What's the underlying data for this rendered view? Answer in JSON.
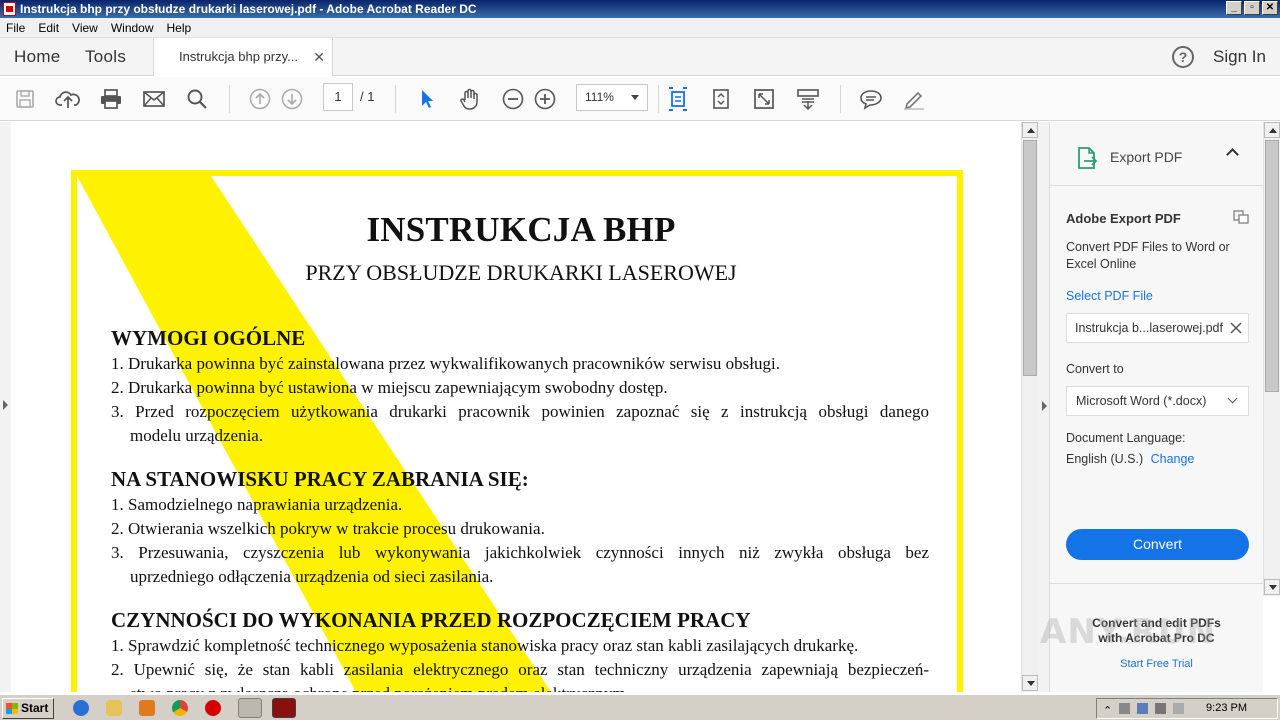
{
  "window": {
    "title": "Instrukcja bhp przy obsłudze drukarki laserowej.pdf - Adobe Acrobat Reader DC",
    "buttons": [
      "_",
      "▫",
      "✕"
    ]
  },
  "menu": [
    "File",
    "Edit",
    "View",
    "Window",
    "Help"
  ],
  "tabs": {
    "home": "Home",
    "tools": "Tools",
    "document": "Instrukcja bhp przy...",
    "sign_in": "Sign In"
  },
  "toolbar": {
    "page_current": "1",
    "page_total": "/ 1",
    "zoom": "111%"
  },
  "document": {
    "title": "INSTRUKCJA BHP",
    "subtitle": "PRZY OBSŁUDZE DRUKARKI LASEROWEJ",
    "sections": [
      {
        "heading": "WYMOGI OGÓLNE",
        "items": [
          "1. Drukarka powinna być zainstalowana przez wykwalifikowanych pracowników serwisu obsługi.",
          "2. Drukarka powinna być ustawiona w miejscu zapewniającym swobodny dostęp.",
          "3. Przed rozpoczęciem użytkowania drukarki pracownik powinien zapoznać się z instrukcją obsługi danego",
          "modelu urządzenia."
        ]
      },
      {
        "heading": "NA STANOWISKU PRACY ZABRANIA SIĘ:",
        "items": [
          "1. Samodzielnego naprawiania urządzenia.",
          "2. Otwierania wszelkich pokryw w trakcie procesu drukowania.",
          "3. Przesuwania, czyszczenia lub wykonywania jakichkolwiek czynności innych niż zwykła obsługa bez",
          "uprzedniego odłączenia urządzenia od sieci zasilania."
        ]
      },
      {
        "heading": "CZYNNOŚCI DO WYKONANIA PRZED ROZPOCZĘCIEM PRACY",
        "items": [
          "1. Sprawdzić kompletność technicznego wyposażenia stanowiska pracy oraz stan kabli zasilających drukarkę.",
          "2. Upewnić się, że stan kabli zasilania elektrycznego oraz stan techniczny urządzenia zapewniają bezpieczeń-",
          "stwo pracy z zwłaszcza ochronę przed porażeniem prądem elektrycznym."
        ]
      }
    ]
  },
  "right_panel": {
    "header": "Export PDF",
    "section_title": "Adobe Export PDF",
    "description": "Convert PDF Files to Word or Excel Online",
    "select_file_link": "Select PDF File",
    "file_name": "Instrukcja b...laserowej.pdf",
    "convert_to_label": "Convert to",
    "convert_to_value": "Microsoft Word (*.docx)",
    "language_label": "Document Language:",
    "language_value": "English (U.S.)",
    "change_link": "Change",
    "convert_button": "Convert",
    "promo_line1": "Convert and edit PDFs",
    "promo_line2": "with Acrobat Pro DC",
    "trial_link": "Start Free Trial"
  },
  "watermark": "ANY.RUN",
  "taskbar": {
    "start": "Start",
    "clock": "9:23 PM"
  },
  "colors": {
    "accent": "#1473e6",
    "highlight_yellow": "#fff200"
  }
}
